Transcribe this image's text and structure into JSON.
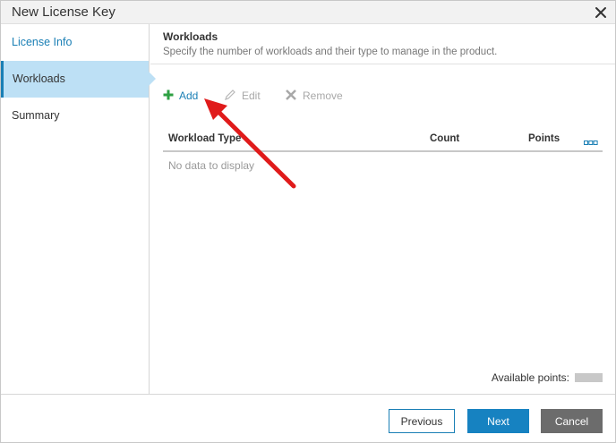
{
  "dialog": {
    "title": "New License Key",
    "close_icon": "close-icon"
  },
  "sidebar": {
    "items": [
      {
        "label": "License Info",
        "state": "link"
      },
      {
        "label": "Workloads",
        "state": "active"
      },
      {
        "label": "Summary",
        "state": "normal"
      }
    ]
  },
  "content": {
    "title": "Workloads",
    "subtitle": "Specify the number of workloads and their type to manage in the product."
  },
  "toolbar": {
    "add_label": "Add",
    "edit_label": "Edit",
    "remove_label": "Remove"
  },
  "grid": {
    "columns": [
      "Workload Type",
      "Count",
      "Points"
    ],
    "empty_text": "No data to display"
  },
  "available_points": {
    "label": "Available points:"
  },
  "footer": {
    "previous_label": "Previous",
    "next_label": "Next",
    "cancel_label": "Cancel"
  },
  "colors": {
    "accent": "#1a7fb5",
    "active_nav": "#bde0f5",
    "add_icon": "#2ea043",
    "annotation_arrow": "#e01b1b"
  }
}
